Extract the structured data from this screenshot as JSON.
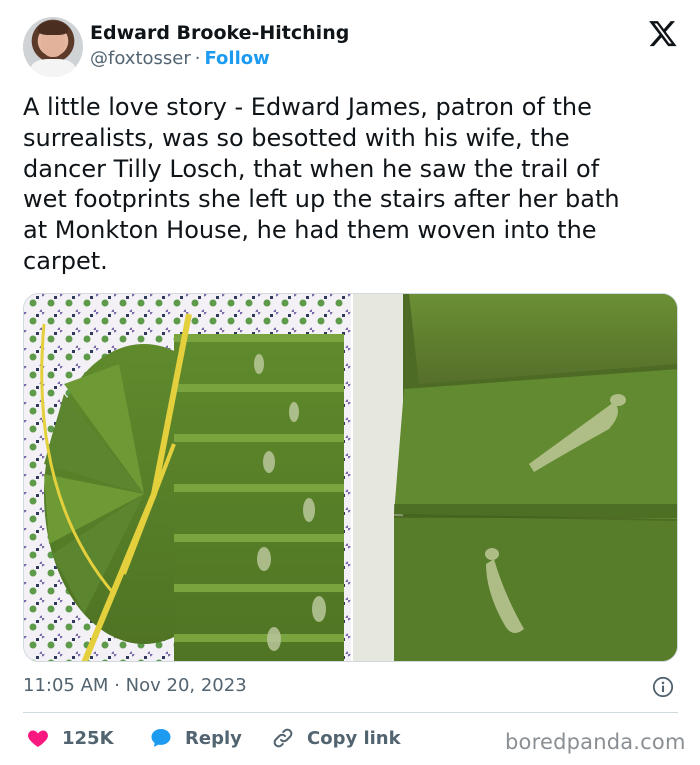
{
  "author": {
    "name": "Edward Brooke-Hitching",
    "handle": "@foxtosser",
    "separator": "·",
    "follow_label": "Follow"
  },
  "platform_icon": "x-logo-icon",
  "tweet": {
    "text": "A little love story - Edward James, patron of the\nsurrealists, was so besotted with his wife, the\ndancer Tilly Losch, that when he saw the trail of\nwet footprints she left up the stairs after her bath\nat Monkton House, he had them woven into the\ncarpet."
  },
  "timestamp": {
    "time": "11:05 AM",
    "separator": "·",
    "date": "Nov 20, 2023"
  },
  "actions": {
    "like_count": "125K",
    "reply_label": "Reply",
    "copy_label": "Copy link"
  },
  "watermark": "boredpanda.com",
  "colors": {
    "accent": "#1d9bf0",
    "like": "#f91880",
    "muted": "#536471",
    "carpet": "#6b8f2e"
  }
}
